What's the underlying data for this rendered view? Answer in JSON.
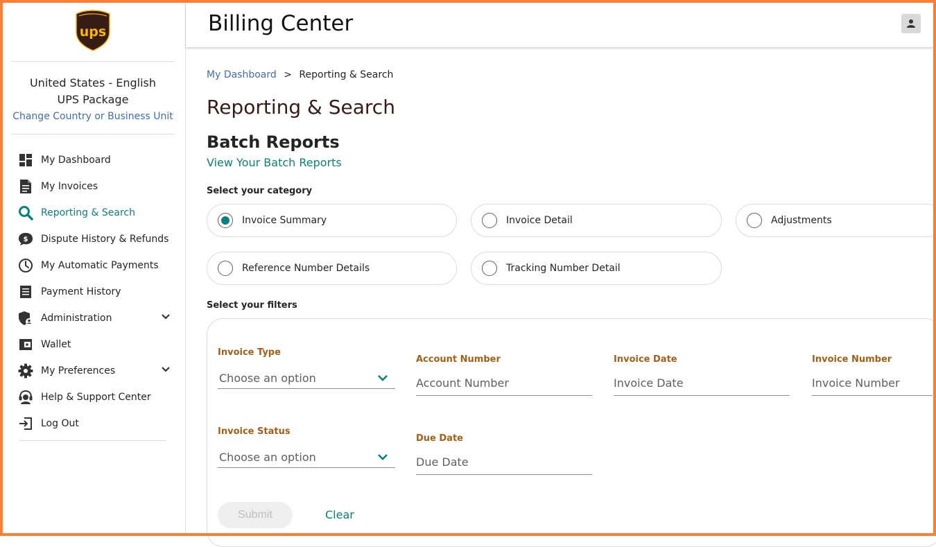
{
  "header": {
    "title": "Billing Center"
  },
  "logo": {
    "text": "ups"
  },
  "locale": {
    "country_language": "United States - English",
    "business_unit": "UPS Package",
    "change_link": "Change Country or Business Unit"
  },
  "nav": {
    "items": [
      {
        "label": "My Dashboard",
        "icon": "dashboard-icon"
      },
      {
        "label": "My Invoices",
        "icon": "document-icon"
      },
      {
        "label": "Reporting & Search",
        "icon": "search-icon",
        "active": true
      },
      {
        "label": "Dispute History & Refunds",
        "icon": "dollar-bubble-icon"
      },
      {
        "label": "My Automatic Payments",
        "icon": "clock-icon"
      },
      {
        "label": "Payment History",
        "icon": "receipt-icon"
      },
      {
        "label": "Administration",
        "icon": "shield-user-icon",
        "expandable": true
      },
      {
        "label": "Wallet",
        "icon": "wallet-icon"
      },
      {
        "label": "My Preferences",
        "icon": "gear-icon",
        "expandable": true
      },
      {
        "label": "Help & Support Center",
        "icon": "headset-icon"
      },
      {
        "label": "Log Out",
        "icon": "logout-icon"
      }
    ]
  },
  "breadcrumb": {
    "home": "My Dashboard",
    "separator": ">",
    "current": "Reporting & Search"
  },
  "page": {
    "title": "Reporting & Search",
    "batch_title": "Batch Reports",
    "batch_link": "View Your Batch Reports",
    "category_label": "Select your category",
    "filters_label": "Select your filters"
  },
  "categories": [
    {
      "label": "Invoice Summary",
      "selected": true
    },
    {
      "label": "Invoice Detail",
      "selected": false
    },
    {
      "label": "Adjustments",
      "selected": false
    },
    {
      "label": "Reference Number Details",
      "selected": false
    },
    {
      "label": "Tracking Number Detail",
      "selected": false
    }
  ],
  "filters": {
    "invoice_type": {
      "label": "Invoice Type",
      "placeholder": "Choose an option"
    },
    "account_number": {
      "label": "Account Number",
      "placeholder": "Account Number"
    },
    "invoice_date": {
      "label": "Invoice Date",
      "placeholder": "Invoice Date"
    },
    "invoice_number": {
      "label": "Invoice Number",
      "placeholder": "Invoice Number"
    },
    "invoice_status": {
      "label": "Invoice Status",
      "placeholder": "Choose an option"
    },
    "due_date": {
      "label": "Due Date",
      "placeholder": "Due Date"
    }
  },
  "actions": {
    "submit": "Submit",
    "clear": "Clear"
  },
  "colors": {
    "accent": "#0a8080",
    "brand_brown": "#351c15",
    "brand_gold": "#ffb500",
    "frame": "#ff7e33",
    "label": "#a06017",
    "link": "#426da9"
  }
}
